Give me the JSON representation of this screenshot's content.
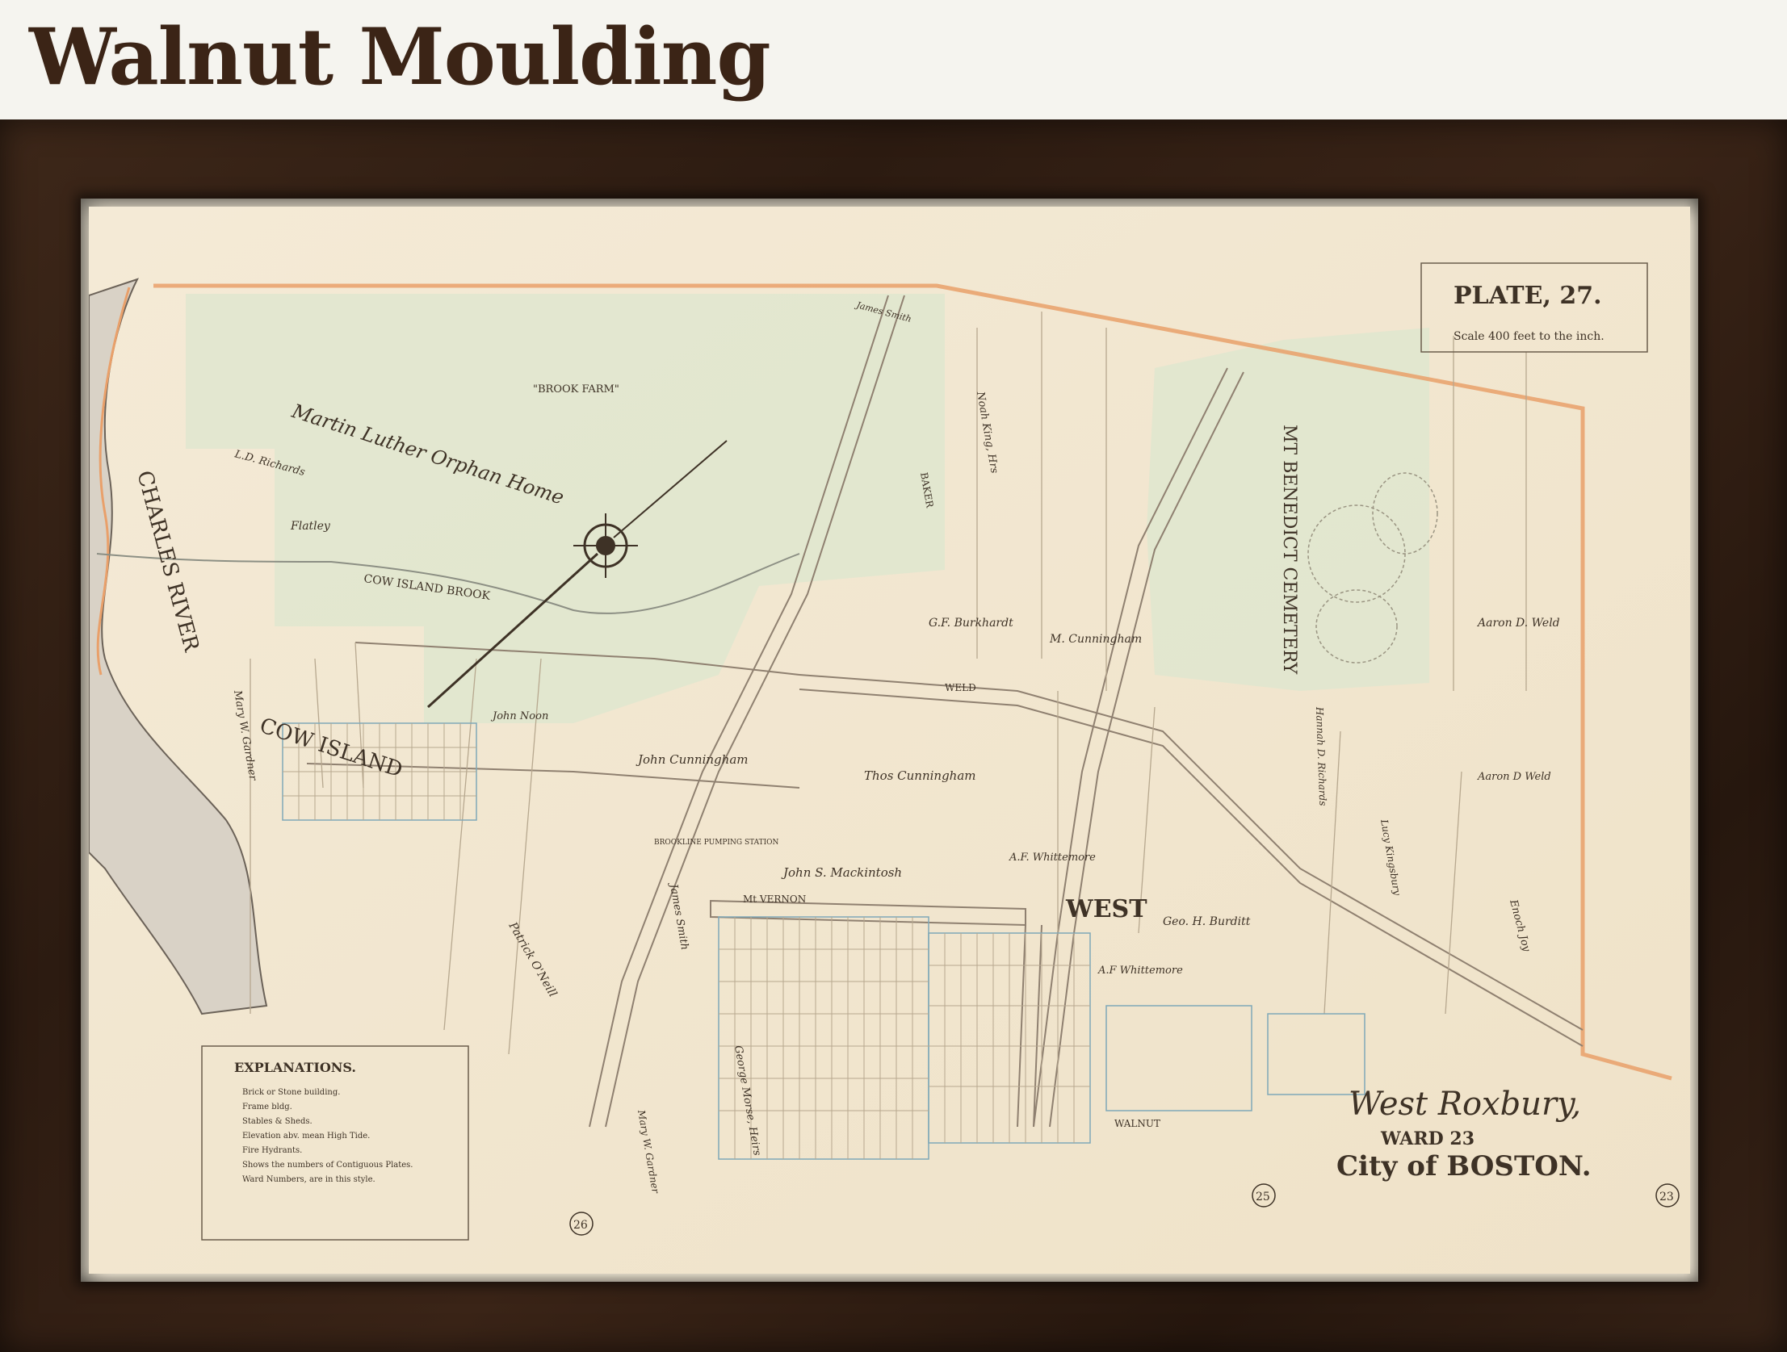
{
  "title": "Walnut Moulding",
  "map": {
    "plate": "PLATE, 27.",
    "scale": "Scale 400 feet to the inch.",
    "ward_title_1": "West Roxbury,",
    "ward_title_2": "WARD 23",
    "ward_title_3": "City of BOSTON.",
    "explanations_title": "EXPLANATIONS.",
    "explanations": [
      "Brick or Stone building.",
      "Frame bldg.",
      "Stables & Sheds.",
      "Elevation abv. mean High Tide.",
      "Fire Hydrants.",
      "Shows the numbers of Contiguous Plates.",
      "Ward Numbers, are in this style."
    ],
    "labels": {
      "brook_farm": "\"BROOK FARM\"",
      "orphan_home": "Martin Luther Orphan Home",
      "cemetery": "MT BENEDICT CEMETERY",
      "charles_river": "CHARLES RIVER",
      "cow_island": "COW ISLAND",
      "cow_island_brook": "COW ISLAND BROOK",
      "west_st": "WEST",
      "weld_st": "WELD",
      "mt_vernon": "Mt VERNON",
      "john_cunningham": "John Cunningham",
      "thos_cunningham": "Thos Cunningham",
      "john_mackintosh": "John S. Mackintosh",
      "aaron_weld": "Aaron D. Weld",
      "aaron_weld_2": "Aaron D Weld",
      "enoch_joy": "Enoch Joy",
      "gf_burkhardt": "G.F. Burkhardt",
      "m_cunningham": "M. Cunningham",
      "geo_burditt": "Geo. H. Burditt",
      "af_whittemore": "A.F. Whittemore",
      "af_whittemore_2": "A.F Whittemore",
      "hannah_richards": "Hannah D. Richards",
      "lucy_kingsbury": "Lucy Kingsbury",
      "patrick_oneill": "Patrick O'Neill",
      "james_smith": "James Smith",
      "james_smith_2": "James Smith",
      "ld_richards": "L.D. Richards",
      "flatley": "Flatley",
      "john_noon": "John Noon",
      "george_morse": "George Morse, Heirs",
      "mary_gardner": "Mary W. Gardner",
      "mary_gardner_2": "Mary W. Gardner",
      "noah_king": "Noah King, Hrs",
      "brookline_station": "BROOKLINE PUMPING STATION",
      "walnut": "WALNUT",
      "baker": "BAKER",
      "plate_26": "26",
      "plate_25": "25",
      "plate_23": "23"
    }
  }
}
